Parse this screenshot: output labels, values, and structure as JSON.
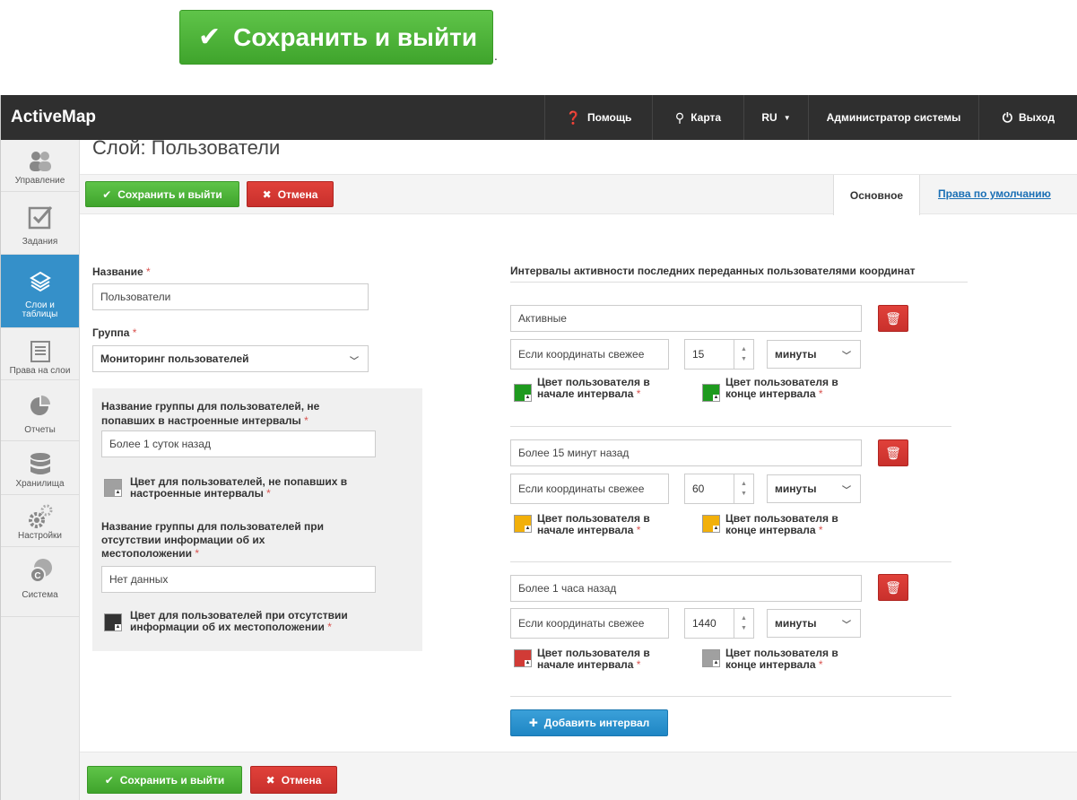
{
  "top_button": {
    "label": "Сохранить и выйти",
    "trailing": "."
  },
  "brand": "ActiveMap",
  "nav": {
    "help": "Помощь",
    "map": "Карта",
    "lang": "RU",
    "user": "Администратор системы",
    "logout": "Выход"
  },
  "sidebar": [
    {
      "label": "Управление",
      "icon": "users-icon"
    },
    {
      "label": "Задания",
      "icon": "checkbox-icon"
    },
    {
      "label": "Слои и таблицы",
      "icon": "layers-icon",
      "active": true
    },
    {
      "label": "Права на слои",
      "icon": "list-icon"
    },
    {
      "label": "Отчеты",
      "icon": "pie-chart-icon"
    },
    {
      "label": "Хранилища",
      "icon": "database-icon"
    },
    {
      "label": "Настройки",
      "icon": "gears-icon"
    },
    {
      "label": "Система",
      "icon": "globe-icon"
    }
  ],
  "page_title": "Слой: Пользователи",
  "actions": {
    "save": "Сохранить и выйти",
    "cancel": "Отмена"
  },
  "tabs": {
    "main": "Основное",
    "defaults": "Права по умолчанию"
  },
  "form": {
    "name_label": "Название",
    "name_value": "Пользователи",
    "group_label": "Группа",
    "group_value": "Мониторинг пользователей",
    "not_in_intervals_label": "Название группы для пользователей, не попавших в настроенные интервалы",
    "not_in_intervals_value": "Более 1 суток назад",
    "not_in_intervals_color_label": "Цвет для пользователей, не попавших в настроенные интервалы",
    "not_in_intervals_color": "#a0a0a0",
    "no_location_label": "Название группы для пользователей при отсутствии информации об их местоположении",
    "no_location_value": "Нет данных",
    "no_location_color_label": "Цвет для пользователей при отсутствии информации об их местоположении",
    "no_location_color": "#333333"
  },
  "intervals_title": "Интервалы активности последних переданных пользователями координат",
  "intervals": [
    {
      "name": "Активные",
      "fresh_label": "Если координаты свежее",
      "value": "15",
      "unit": "минуты",
      "start_label": "Цвет пользователя в начале интервала",
      "end_label": "Цвет пользователя в конце интервала",
      "start_color": "#1e9a1e",
      "end_color": "#1e9a1e"
    },
    {
      "name": "Более 15 минут назад",
      "fresh_label": "Если координаты свежее",
      "value": "60",
      "unit": "минуты",
      "start_label": "Цвет пользователя в начале интервала",
      "end_label": "Цвет пользователя в конце интервала",
      "start_color": "#f2b00a",
      "end_color": "#f2b00a"
    },
    {
      "name": "Более 1 часа назад",
      "fresh_label": "Если координаты свежее",
      "value": "1440",
      "unit": "минуты",
      "start_label": "Цвет пользователя в начале интервала",
      "end_label": "Цвет пользователя в конце интервала",
      "start_color": "#d13b36",
      "end_color": "#a0a0a0"
    }
  ],
  "add_interval": "Добавить интервал",
  "required_mark": "*"
}
